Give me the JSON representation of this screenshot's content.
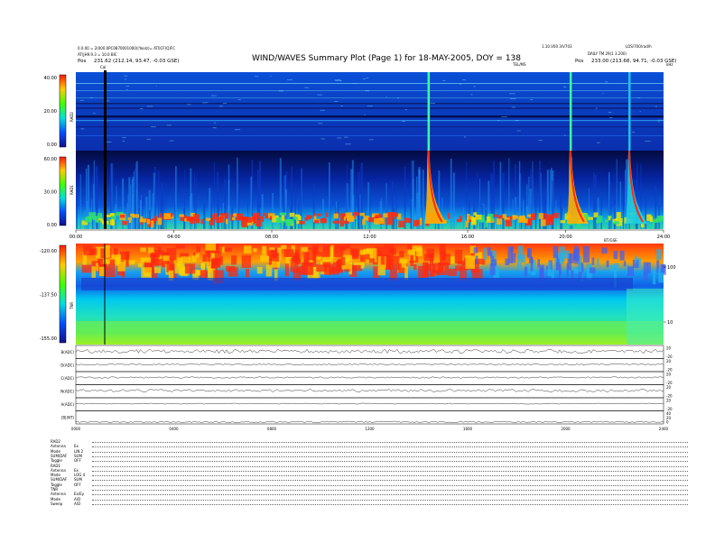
{
  "header": {
    "title": "WIND/WAVES Summary Plot (Page 1) for 18-MAY-2005, DOY = 138",
    "left_line1": "0.0.00 = 2(000.0PC0870001000)(Yoolz)= AT0CF(Q)FC",
    "left_line2": "AT(JH9.9.3 = 10.0 BIC",
    "left_pos_label": "Pos",
    "left_pos_value": "231.62 (212.14, 93.47, -0.03 GSE)",
    "right_line1": "LOS/700/rad/h",
    "right_line2": "DAILY TM 29(1 3.200)",
    "right_pos_label": "Pos",
    "right_pos_value": "233.00 (213.68, 94.71, -0.03 GSE)",
    "center_small": "1.10.V00 3/V703",
    "center_small2": "TEL/MS",
    "right_unit": "kHz",
    "cal_label": "Cal"
  },
  "panels": {
    "rad2": {
      "label": "RAD2",
      "ticks": [
        "40.00",
        "20.00",
        "0.00"
      ],
      "tick_values": [
        40,
        20,
        0
      ]
    },
    "rad1": {
      "label": "RAD1",
      "ticks": [
        "60.00",
        "30.00",
        "0.00"
      ],
      "tick_values": [
        60,
        30,
        0
      ]
    },
    "tnr": {
      "label": "TNR",
      "ticks": [
        "-120.00",
        "-137.50",
        "-155.00"
      ],
      "tick_values": [
        -120,
        -137.5,
        -155
      ],
      "right_ticks": [
        "100",
        "10"
      ],
      "right_tick_values": [
        100,
        10
      ]
    }
  },
  "time_axis": {
    "ticks": [
      "00:00",
      "04:00",
      "08:00",
      "12:00",
      "16:00",
      "20:00",
      "24:00"
    ],
    "tick_hours": [
      0,
      4,
      8,
      12,
      16,
      20,
      24
    ],
    "extra_label": "BT/GSE",
    "bottom_ticks": [
      "0000",
      "0400",
      "0800",
      "1200",
      "1600",
      "2000",
      "2400"
    ]
  },
  "line_panels": [
    {
      "label": "B(ADC)",
      "right_ticks": [
        "20",
        "-20"
      ]
    },
    {
      "label": "D(ADC)",
      "right_ticks": [
        "20",
        "-20"
      ]
    },
    {
      "label": "C(ADC)",
      "right_ticks": [
        "20",
        "-20"
      ]
    },
    {
      "label": "N(ADC)",
      "right_ticks": [
        "20",
        "-20"
      ]
    },
    {
      "label": "A(ADC)",
      "right_ticks": [
        "20",
        "-20"
      ]
    },
    {
      "label": "|B|(NT)",
      "right_ticks": [
        "40",
        "20",
        "0"
      ]
    }
  ],
  "footer": [
    {
      "key": "RAD2",
      "value": ""
    },
    {
      "key": "Antenna",
      "value": "Ex"
    },
    {
      "key": "Mode",
      "value": "LIN 2"
    },
    {
      "key": "SUM/DAF",
      "value": "SUM"
    },
    {
      "key": "Toggle",
      "value": "OFF"
    },
    {
      "key": "RAD1",
      "value": ""
    },
    {
      "key": "Antenna",
      "value": "Ex"
    },
    {
      "key": "Mode",
      "value": "LOG 4"
    },
    {
      "key": "SUM/DAF",
      "value": "SUM"
    },
    {
      "key": "Toggle",
      "value": "OFF"
    },
    {
      "key": "TNR",
      "value": ""
    },
    {
      "key": "Antenna",
      "value": "Ex/Ey"
    },
    {
      "key": "Mode",
      "value": "A/D"
    },
    {
      "key": "Sweep",
      "value": "A/D"
    }
  ],
  "colors": {
    "background": "#0a2bb8",
    "scale_top": "#ff2a00",
    "scale_mid": "#00e040",
    "scale_low": "#00e0ff",
    "scale_bottom": "#1a1aa0"
  },
  "chart_data": {
    "type": "heatmap",
    "title": "WIND/WAVES Summary Plot (Page 1) for 18-MAY-2005, DOY = 138",
    "xlim": [
      0,
      24
    ],
    "bursts_hours": [
      14.4,
      20.2,
      22.6
    ],
    "panels": [
      "RAD2",
      "RAD1",
      "TNR"
    ]
  }
}
